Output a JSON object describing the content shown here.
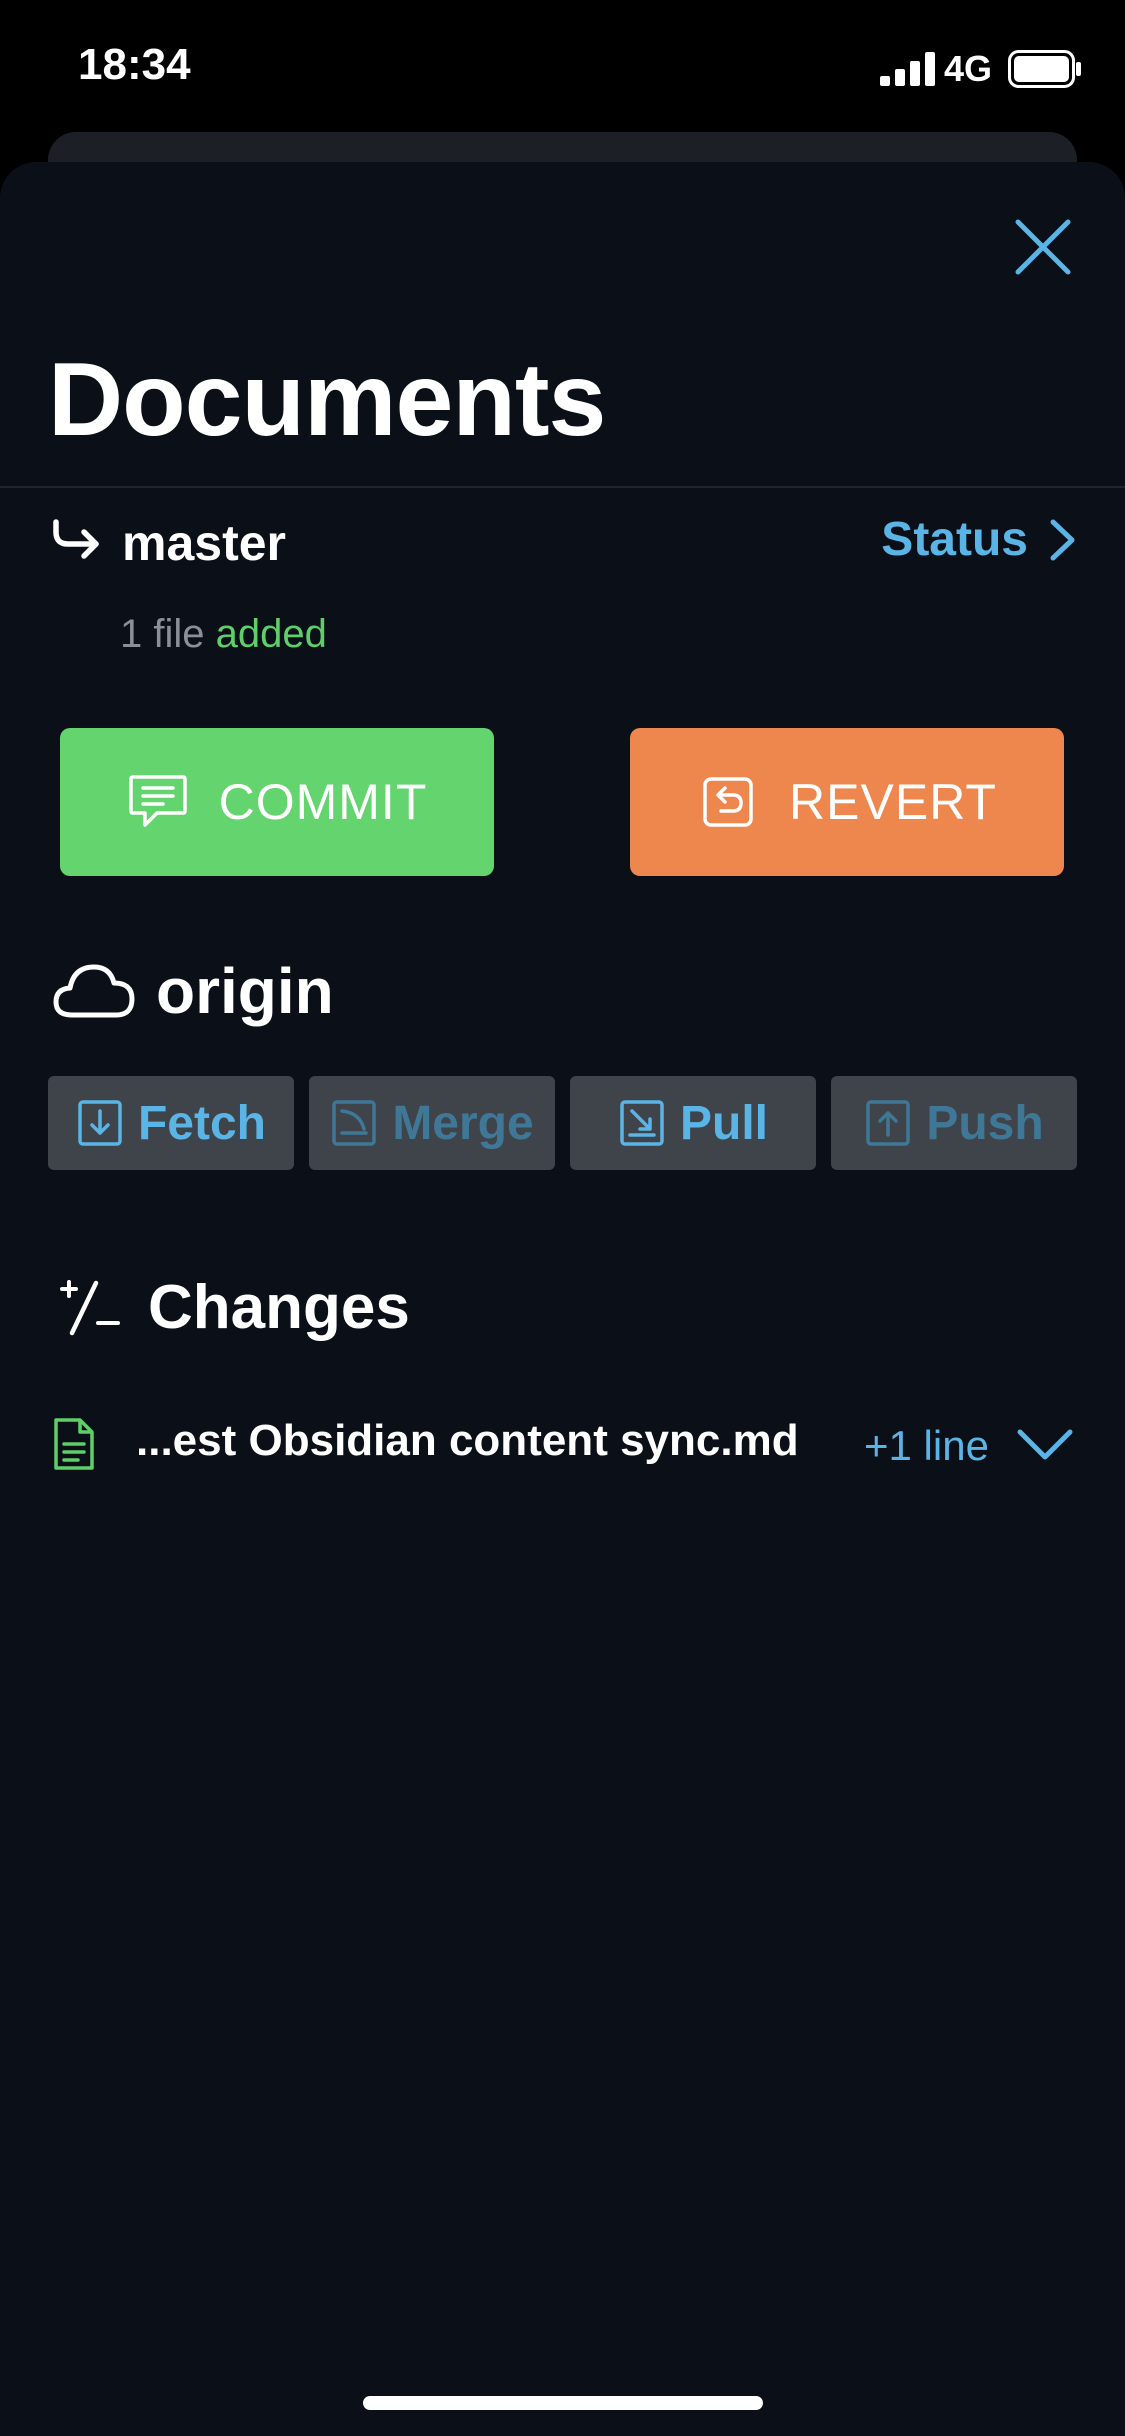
{
  "status_bar": {
    "time": "18:34",
    "network": "4G"
  },
  "header": {
    "title": "Documents"
  },
  "branch": {
    "name": "master",
    "status_label": "Status"
  },
  "summary": {
    "prefix": "1 file",
    "state": "added"
  },
  "buttons": {
    "commit": "COMMIT",
    "revert": "REVERT"
  },
  "remote": {
    "name": "origin",
    "actions": [
      {
        "label": "Fetch",
        "enabled": true
      },
      {
        "label": "Merge",
        "enabled": false
      },
      {
        "label": "Pull",
        "enabled": true
      },
      {
        "label": "Push",
        "enabled": false
      }
    ]
  },
  "changes": {
    "title": "Changes",
    "items": [
      {
        "file": "...est Obsidian content sync.md",
        "delta": "+1 line"
      }
    ]
  },
  "colors": {
    "accent": "#5ab4e6",
    "commit": "#63d46e",
    "revert": "#ed874d",
    "added": "#5fcf6a",
    "sheet": "#0b0f17"
  }
}
